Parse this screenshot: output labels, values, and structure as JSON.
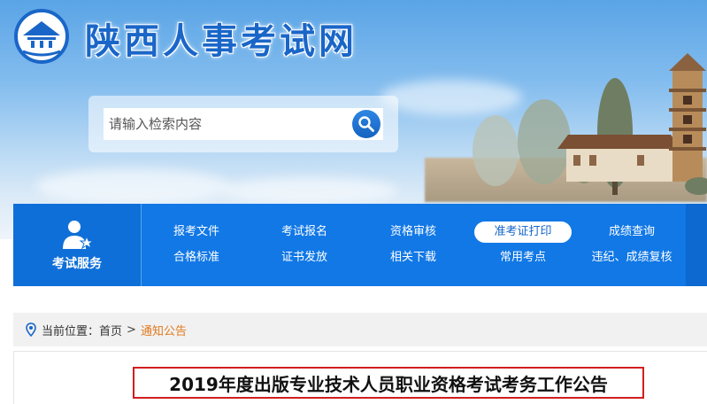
{
  "header": {
    "site_title": "陕西人事考试网",
    "logo_icon": "building-emblem-icon"
  },
  "search": {
    "placeholder": "请输入检索内容",
    "button_icon": "search-icon"
  },
  "nav": {
    "service_label": "考试服务",
    "service_icon": "person-star-icon",
    "rows": [
      [
        "报考文件",
        "考试报名",
        "资格审核",
        "准考证打印",
        "成绩查询"
      ],
      [
        "合格标准",
        "证书发放",
        "相关下载",
        "常用考点",
        "违纪、成绩复核"
      ]
    ],
    "active_item": "准考证打印"
  },
  "breadcrumb": {
    "prefix": "当前位置：",
    "home": "首页",
    "separator": ">",
    "current": "通知公告"
  },
  "article": {
    "title": "2019年度出版专业技术人员职业资格考试考务工作公告"
  },
  "colors": {
    "nav_blue": "#1178e6",
    "title_blue": "#1a66c8",
    "highlight_red": "#d21e1e",
    "current_orange": "#e07a1e"
  }
}
